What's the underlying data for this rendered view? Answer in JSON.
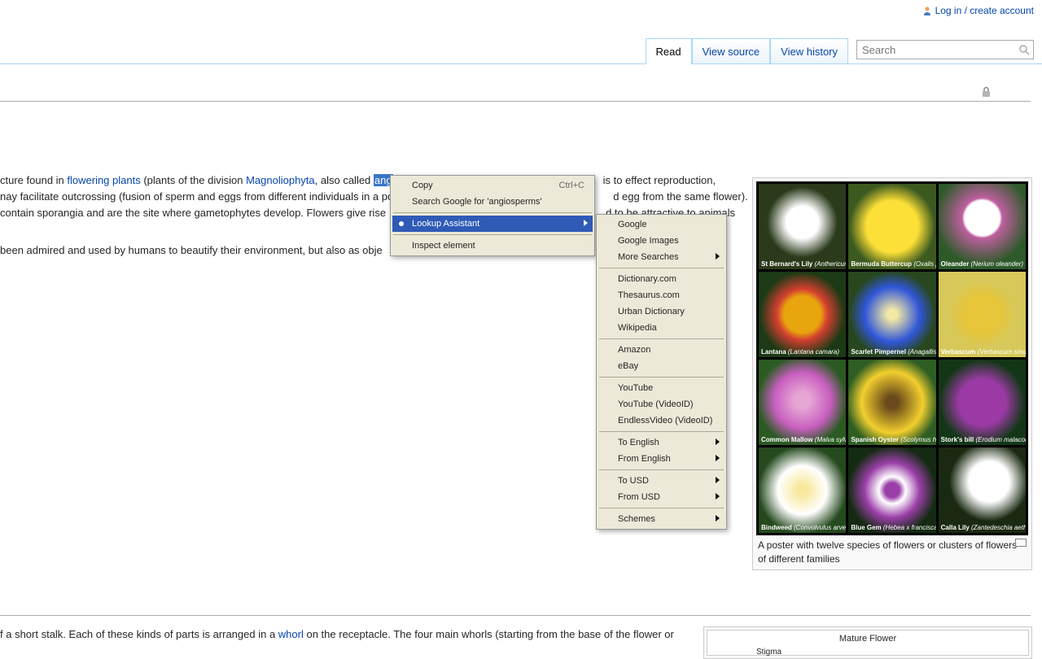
{
  "top": {
    "login": "Log in / create account"
  },
  "tabs": {
    "read": "Read",
    "view_source": "View source",
    "view_history": "View history"
  },
  "search": {
    "placeholder": "Search"
  },
  "article": {
    "p1_a": "cture found in ",
    "p1_link1": "flowering plants",
    "p1_b": " (plants of the division ",
    "p1_link2": "Magnoliophyta",
    "p1_c": ", also called ",
    "p1_hl": "ang",
    "p1_d": "is to effect reproduction,",
    "p2_a": "nay facilitate outcrossing (fusion of sperm and eggs from different individuals in a po",
    "p2_b": "d egg from the same flower).",
    "p3_a": " contain sporangia and are the site where gametophytes develop. Flowers give rise",
    "p3_b": "d to be attractive to animals",
    "p4": " been admired and used by humans to beautify their environment, but also as obje",
    "bottom_a": "f a short stalk. Each of these kinds of parts is arranged in a ",
    "bottom_link": "whorl",
    "bottom_b": " on the receptacle. The four main whorls (starting from the base of the flower or"
  },
  "figure": {
    "caption": "A poster with twelve species of flowers or clusters of flowers of different families",
    "cells": [
      {
        "name": "St Bernard's Lily",
        "sci": "(Anthericum liliago)"
      },
      {
        "name": "Bermuda Buttercup",
        "sci": "(Oxalis pes-caprae)"
      },
      {
        "name": "Oleander",
        "sci": "(Nerium oleander)"
      },
      {
        "name": "Lantana",
        "sci": "(Lantana camara)"
      },
      {
        "name": "Scarlet Pimpernel",
        "sci": "(Anagallis arvensis)"
      },
      {
        "name": "Verbascum",
        "sci": "(Verbascum sinuatum)"
      },
      {
        "name": "Common Mallow",
        "sci": "(Malva sylvestris)"
      },
      {
        "name": "Spanish Oyster",
        "sci": "(Scolymus hispanicus)"
      },
      {
        "name": "Stork's bill",
        "sci": "(Erodium malacoides)"
      },
      {
        "name": "Bindweed",
        "sci": "(Convolvulus arvensis)"
      },
      {
        "name": "Blue Gem",
        "sci": "(Hebea x franciscana)"
      },
      {
        "name": "Calla Lily",
        "sci": "(Zantedeschia aethiopica)"
      }
    ]
  },
  "diagram": {
    "title": "Mature Flower",
    "stigma": "Stigma"
  },
  "context_menu": {
    "copy": "Copy",
    "copy_shortcut": "Ctrl+C",
    "search_google": "Search Google for 'angiosperms'",
    "lookup": "Lookup Assistant",
    "inspect": "Inspect element"
  },
  "submenu": {
    "google": "Google",
    "google_images": "Google Images",
    "more_searches": "More Searches",
    "dictionary": "Dictionary.com",
    "thesaurus": "Thesaurus.com",
    "urban": "Urban Dictionary",
    "wikipedia": "Wikipedia",
    "amazon": "Amazon",
    "ebay": "eBay",
    "youtube": "YouTube",
    "youtube_vid": "YouTube (VideoID)",
    "endless": "EndlessVideo (VideoID)",
    "to_english": "To English",
    "from_english": "From English",
    "to_usd": "To USD",
    "from_usd": "From USD",
    "schemes": "Schemes"
  }
}
